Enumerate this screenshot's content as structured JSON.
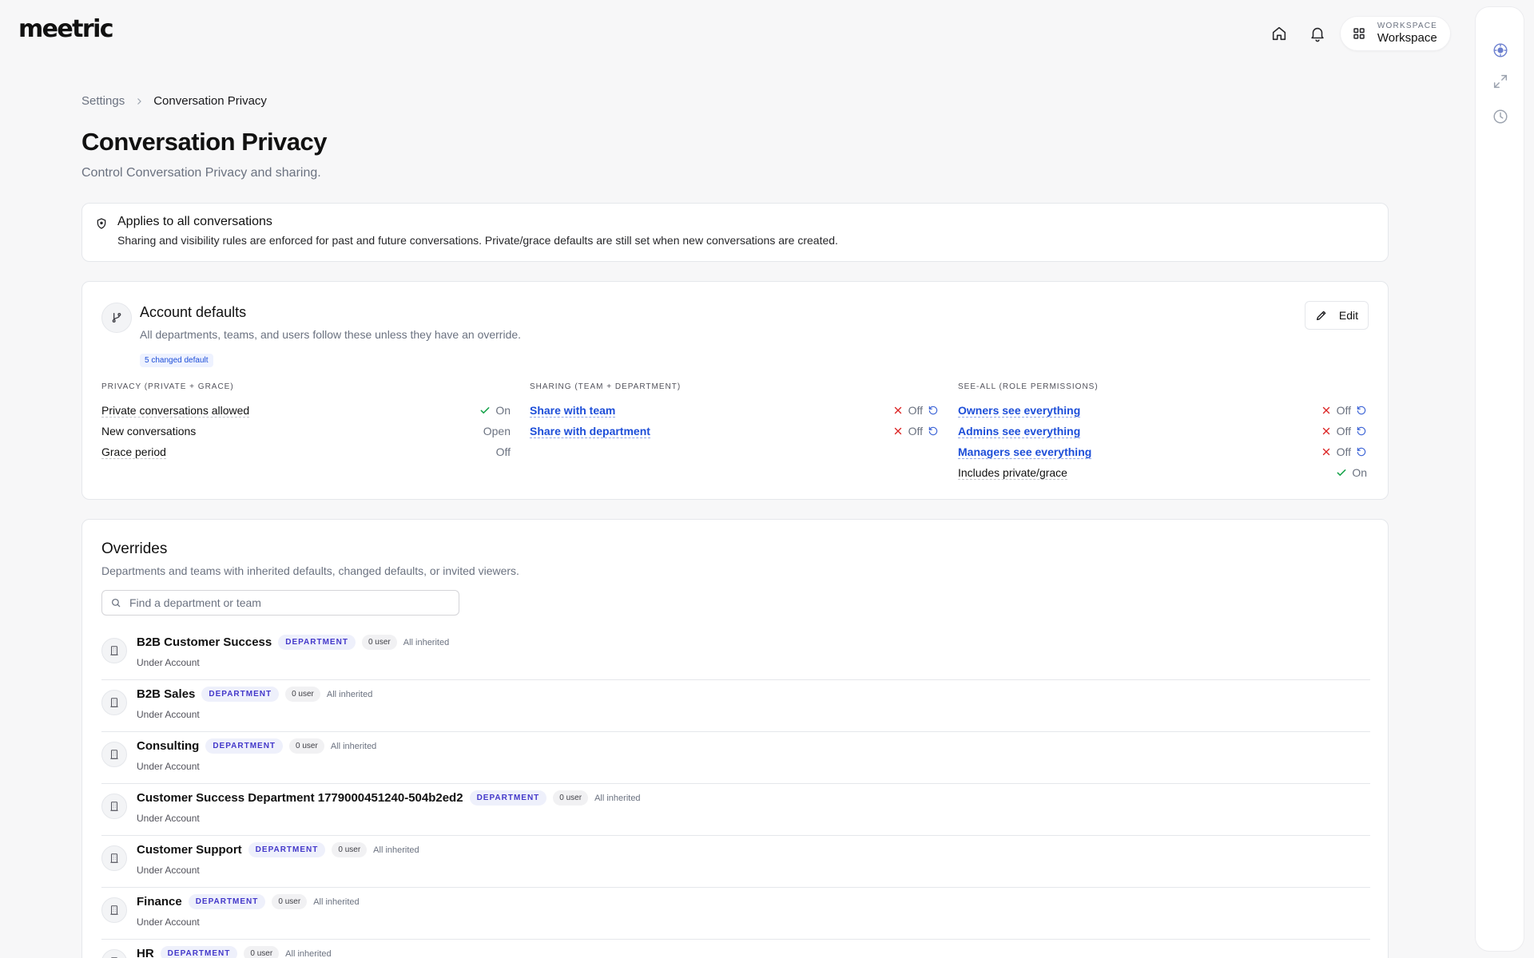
{
  "brand": {
    "logo": "meetric"
  },
  "topbar": {
    "workspace_caption": "WORKSPACE",
    "workspace_name": "Workspace"
  },
  "breadcrumb": {
    "parent": "Settings",
    "current": "Conversation Privacy"
  },
  "page": {
    "title": "Conversation Privacy",
    "subtitle": "Control Conversation Privacy and sharing."
  },
  "notice": {
    "title": "Applies to all conversations",
    "text": "Sharing and visibility rules are enforced for past and future conversations. Private/grace defaults are still set when new conversations are created."
  },
  "defaults": {
    "title": "Account defaults",
    "subtitle": "All departments, teams, and users follow these unless they have an override.",
    "badge": "5 changed default",
    "edit_label": "Edit",
    "privacy": {
      "heading": "PRIVACY (PRIVATE + GRACE)",
      "rows": [
        {
          "label": "Private conversations allowed",
          "value": "On"
        },
        {
          "label": "New conversations",
          "value": "Open"
        },
        {
          "label": "Grace period",
          "value": "Off"
        }
      ]
    },
    "sharing": {
      "heading": "SHARING (TEAM + DEPARTMENT)",
      "rows": [
        {
          "label": "Share with team",
          "value": "Off"
        },
        {
          "label": "Share with department",
          "value": "Off"
        }
      ]
    },
    "seeall": {
      "heading": "SEE-ALL (ROLE PERMISSIONS)",
      "rows": [
        {
          "label": "Owners see everything",
          "value": "Off"
        },
        {
          "label": "Admins see everything",
          "value": "Off"
        },
        {
          "label": "Managers see everything",
          "value": "Off"
        },
        {
          "label": "Includes private/grace",
          "value": "On"
        }
      ]
    }
  },
  "overrides": {
    "title": "Overrides",
    "subtitle": "Departments and teams with inherited defaults, changed defaults, or invited viewers.",
    "search_placeholder": "Find a department or team",
    "items": [
      {
        "name": "B2B Customer Success",
        "tag": "DEPARTMENT",
        "users": "0 user",
        "status": "All inherited",
        "under": "Under Account"
      },
      {
        "name": "B2B Sales",
        "tag": "DEPARTMENT",
        "users": "0 user",
        "status": "All inherited",
        "under": "Under Account"
      },
      {
        "name": "Consulting",
        "tag": "DEPARTMENT",
        "users": "0 user",
        "status": "All inherited",
        "under": "Under Account"
      },
      {
        "name": "Customer Success Department 1779000451240-504b2ed2",
        "tag": "DEPARTMENT",
        "users": "0 user",
        "status": "All inherited",
        "under": "Under Account"
      },
      {
        "name": "Customer Support",
        "tag": "DEPARTMENT",
        "users": "0 user",
        "status": "All inherited",
        "under": "Under Account"
      },
      {
        "name": "Finance",
        "tag": "DEPARTMENT",
        "users": "0 user",
        "status": "All inherited",
        "under": "Under Account"
      },
      {
        "name": "HR",
        "tag": "DEPARTMENT",
        "users": "0 user",
        "status": "All inherited",
        "under": ""
      }
    ]
  },
  "colors": {
    "link": "#1d4ed8",
    "on_check": "#16a34a",
    "off_x": "#dc2626",
    "tag_text": "#4338ca"
  }
}
